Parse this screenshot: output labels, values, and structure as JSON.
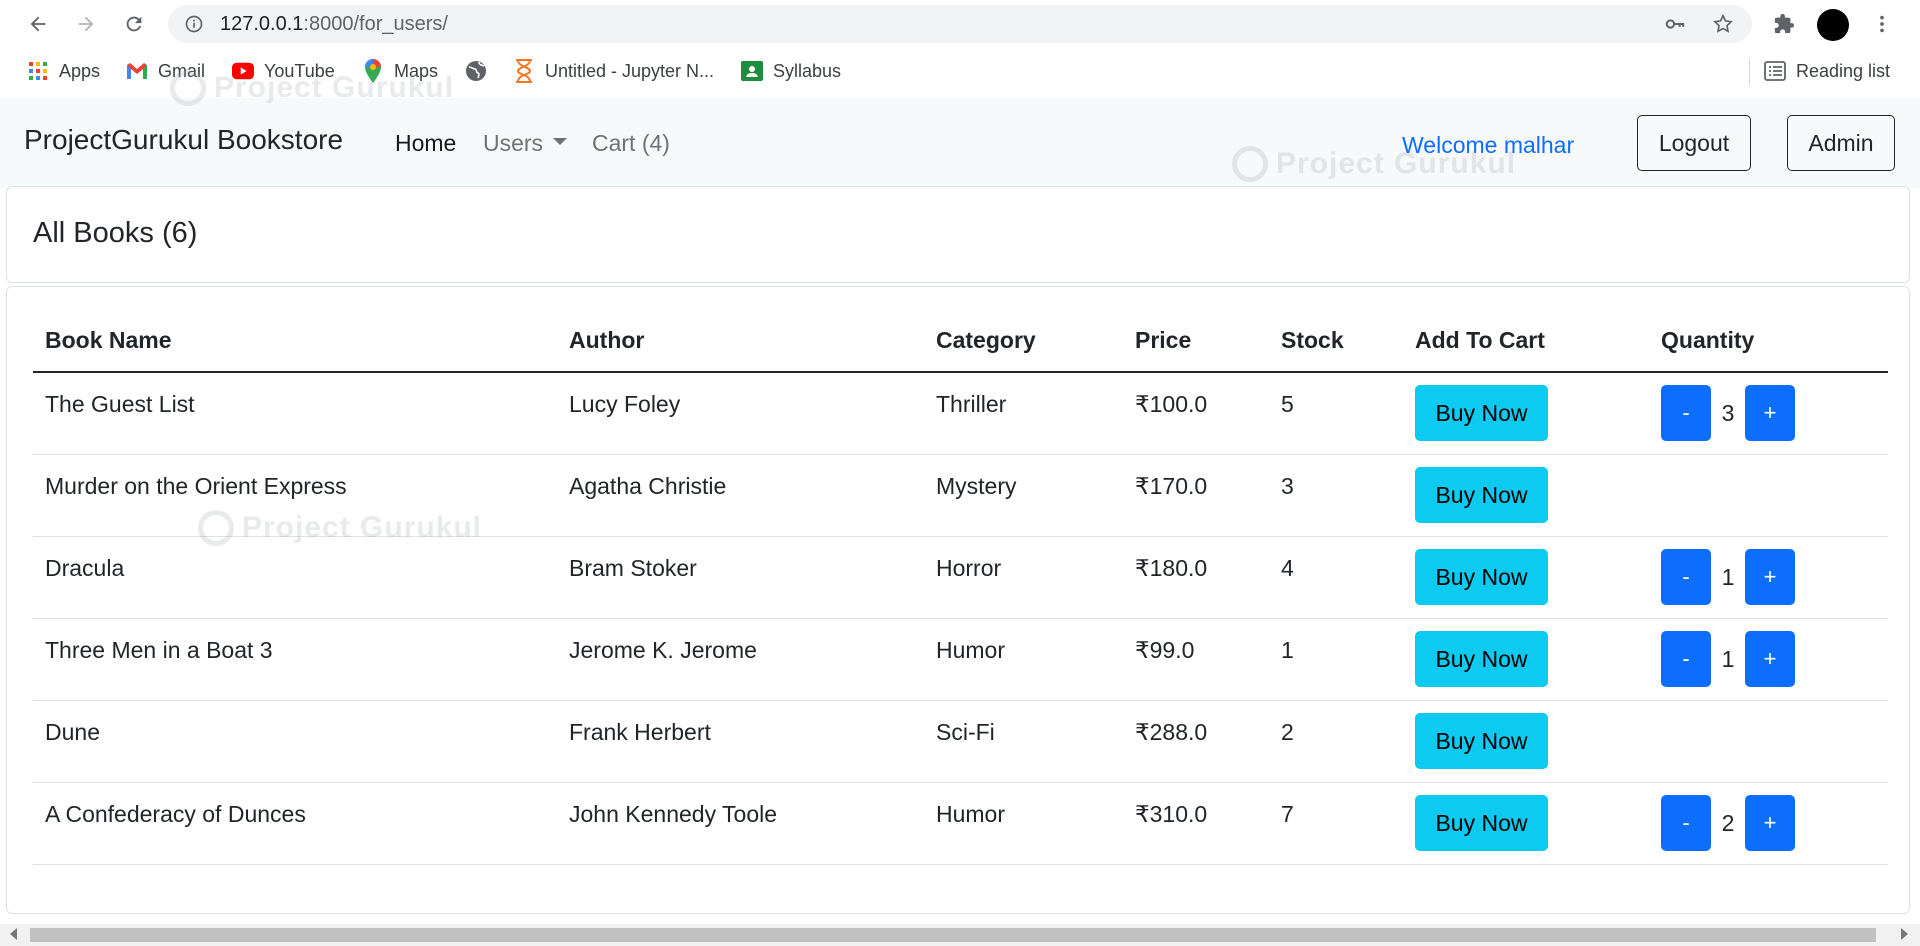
{
  "browser": {
    "url_host": "127.0.0.1",
    "url_path": ":8000/for_users/",
    "bookmarks": [
      {
        "label": "Apps",
        "icon": "apps-grid-icon"
      },
      {
        "label": "Gmail",
        "icon": "gmail-icon"
      },
      {
        "label": "YouTube",
        "icon": "youtube-icon"
      },
      {
        "label": "Maps",
        "icon": "maps-icon"
      },
      {
        "label": "",
        "icon": "globe-icon"
      },
      {
        "label": "Untitled - Jupyter N...",
        "icon": "hourglass-icon"
      },
      {
        "label": "Syllabus",
        "icon": "classroom-icon"
      }
    ],
    "reading_list": "Reading list"
  },
  "navbar": {
    "brand": "ProjectGurukul Bookstore",
    "home": "Home",
    "users": "Users",
    "cart": "Cart (4)",
    "welcome": "Welcome malhar",
    "logout": "Logout",
    "admin": "Admin"
  },
  "watermark": "Project Gurukul",
  "page": {
    "title": "All Books (6)"
  },
  "table": {
    "headers": [
      "Book Name",
      "Author",
      "Category",
      "Price",
      "Stock",
      "Add To Cart",
      "Quantity"
    ],
    "buy_label": "Buy Now",
    "minus_label": "-",
    "plus_label": "+",
    "rows": [
      {
        "name": "The Guest List",
        "author": "Lucy Foley",
        "category": "Thriller",
        "price": "₹100.0",
        "stock": "5",
        "qty": "3"
      },
      {
        "name": "Murder on the Orient Express",
        "author": "Agatha Christie",
        "category": "Mystery",
        "price": "₹170.0",
        "stock": "3",
        "qty": null
      },
      {
        "name": "Dracula",
        "author": "Bram Stoker",
        "category": "Horror",
        "price": "₹180.0",
        "stock": "4",
        "qty": "1"
      },
      {
        "name": "Three Men in a Boat 3",
        "author": "Jerome K. Jerome",
        "category": "Humor",
        "price": "₹99.0",
        "stock": "1",
        "qty": "1"
      },
      {
        "name": "Dune",
        "author": "Frank Herbert",
        "category": "Sci-Fi",
        "price": "₹288.0",
        "stock": "2",
        "qty": null
      },
      {
        "name": "A Confederacy of Dunces",
        "author": "John Kennedy Toole",
        "category": "Humor",
        "price": "₹310.0",
        "stock": "7",
        "qty": "2"
      }
    ]
  },
  "colors": {
    "primary": "#0d6efd",
    "info": "#0dcaf0",
    "navbar_bg": "#f8f9fa"
  }
}
